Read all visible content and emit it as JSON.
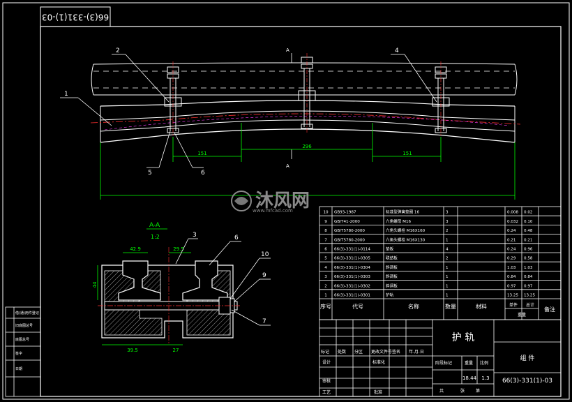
{
  "drawing": {
    "code_rotated": "66(3)-331(1)-03",
    "title": "护 轨",
    "assembly_label": "组 件",
    "code": "66(3)-331(1)-03",
    "watermark_text": "沐风网",
    "watermark_url": "www.mfcad.com",
    "scale": "1.3",
    "weight": "18.44",
    "colors": {
      "bg": "#000000",
      "line": "#ffffff",
      "green": "#00ff00",
      "red": "#ff3030",
      "magenta": "#ff40ff"
    }
  },
  "elevation": {
    "section_mark": "A",
    "dim_left": "151",
    "dim_mid": "296",
    "dim_right": "151",
    "balloons": [
      "1",
      "2",
      "4",
      "5",
      "6"
    ]
  },
  "section": {
    "title": "A-A",
    "scale": "1:2",
    "dim_top_left": "42.9",
    "dim_top_right": "29.5",
    "dim_height": "44",
    "dim_bottom_left": "39.5",
    "dim_bottom_right": "27",
    "balloons": [
      "3",
      "6",
      "10",
      "9",
      "7"
    ]
  },
  "bom": {
    "rows": [
      {
        "seq": "10",
        "code": "GB93-1987",
        "name": "标准型弹簧垫圈 16",
        "qty": "3",
        "mat": "",
        "unit": "0.008",
        "total": "0.02"
      },
      {
        "seq": "9",
        "code": "GB/T41-2000",
        "name": "六角螺母 M16",
        "qty": "3",
        "mat": "",
        "unit": "0.032",
        "total": "0.10"
      },
      {
        "seq": "8",
        "code": "GB/T5780-2000",
        "name": "六角头螺栓 M16X160",
        "qty": "2",
        "mat": "",
        "unit": "0.24",
        "total": "0.48"
      },
      {
        "seq": "7",
        "code": "GB/T5780-2000",
        "name": "六角头螺栓 M16X130",
        "qty": "1",
        "mat": "",
        "unit": "0.21",
        "total": "0.21"
      },
      {
        "seq": "6",
        "code": "66(3)-331(1)-0114",
        "name": "垫板",
        "qty": "4",
        "mat": "",
        "unit": "0.24",
        "total": "0.96"
      },
      {
        "seq": "5",
        "code": "66(3)-331(1)-0305",
        "name": "联结板",
        "qty": "2",
        "mat": "",
        "unit": "0.29",
        "total": "0.58"
      },
      {
        "seq": "4",
        "code": "66(3)-331(1)-0304",
        "name": "斜调板",
        "qty": "1",
        "mat": "",
        "unit": "1.03",
        "total": "1.03"
      },
      {
        "seq": "3",
        "code": "66(3)-331(1)-0303",
        "name": "斜调板",
        "qty": "1",
        "mat": "",
        "unit": "0.84",
        "total": "0.84"
      },
      {
        "seq": "2",
        "code": "66(3)-331(1)-0302",
        "name": "斜调板",
        "qty": "1",
        "mat": "",
        "unit": "0.97",
        "total": "0.97"
      },
      {
        "seq": "1",
        "code": "66(3)-331(1)-0301",
        "name": "护轨",
        "qty": "1",
        "mat": "",
        "unit": "13.25",
        "total": "13.25"
      }
    ],
    "header": {
      "seq": "序号",
      "code": "代号",
      "name": "名称",
      "qty": "数量",
      "mat": "材料",
      "unit": "单件",
      "total": "总计",
      "weight": "重量",
      "remark": "备注"
    }
  },
  "titleblock": {
    "row_labels": [
      "标记",
      "处数",
      "分区",
      "更改文件号",
      "签名",
      "年.月.日"
    ],
    "design": "设计",
    "standardize": "标准化",
    "review": "审核",
    "process": "工艺",
    "approve": "批准",
    "stage": "阶段标记",
    "mass": "重量",
    "scale_label": "比例",
    "total_sheets": "共",
    "sheet": "张",
    "page": "第"
  },
  "sidebar": {
    "labels": [
      "借(通)用件登记",
      "旧底图总号",
      "底图总号",
      "签字",
      "日期"
    ]
  }
}
